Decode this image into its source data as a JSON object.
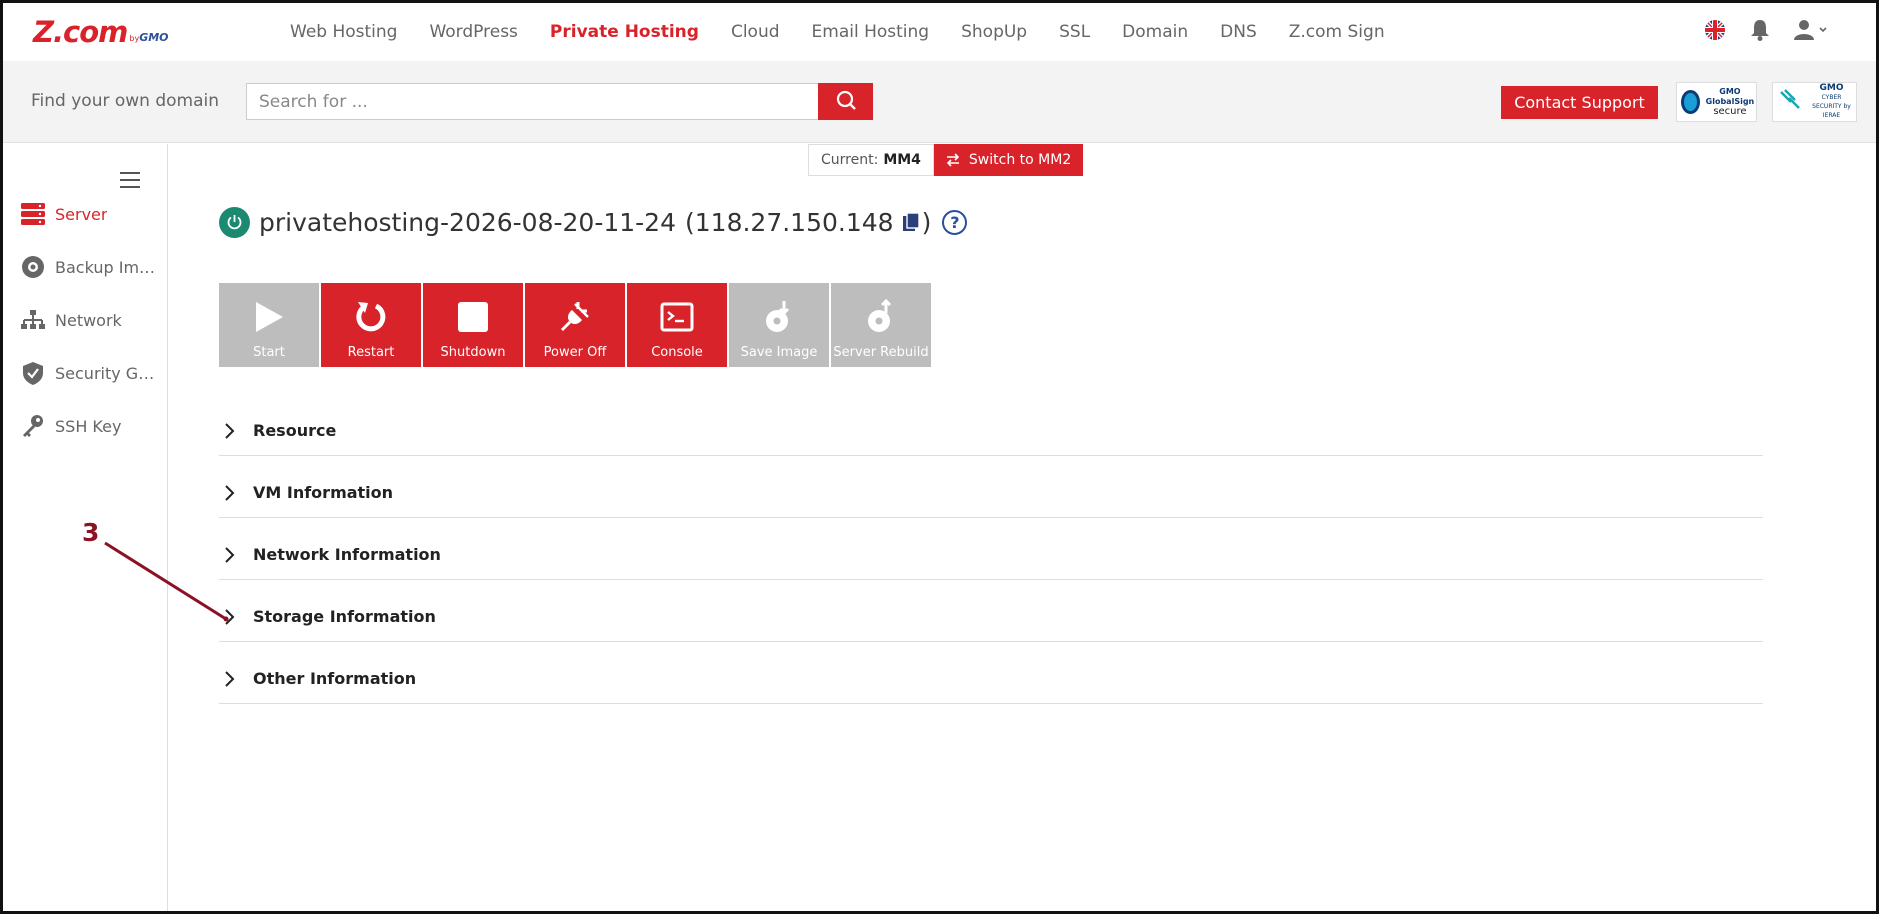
{
  "logo": {
    "main": "Z.com",
    "by": "by",
    "gmo": "GMO"
  },
  "nav": {
    "items": [
      "Web Hosting",
      "WordPress",
      "Private Hosting",
      "Cloud",
      "Email Hosting",
      "ShopUp",
      "SSL",
      "Domain",
      "DNS",
      "Z.com Sign"
    ],
    "active": "Private Hosting"
  },
  "domainbar": {
    "label": "Find your own domain",
    "search_placeholder": "Search for ...",
    "contact_label": "Contact Support",
    "badge1": {
      "brand": "GMO GlobalSign",
      "word": "secure"
    },
    "badge2": {
      "brand": "GMO",
      "sub": "CYBER SECURITY by IERAE"
    }
  },
  "sidebar": {
    "items": [
      {
        "label": "Server",
        "icon": "server-icon",
        "active": true
      },
      {
        "label": "Backup Image",
        "icon": "disc-icon",
        "active": false
      },
      {
        "label": "Network",
        "icon": "network-icon",
        "active": false
      },
      {
        "label": "Security Group",
        "icon": "shield-icon",
        "active": false
      },
      {
        "label": "SSH Key",
        "icon": "key-icon",
        "active": false
      }
    ]
  },
  "mm": {
    "current_label": "Current:",
    "current_value": "MM4",
    "switch_label": "Switch to MM2"
  },
  "server": {
    "name": "privatehosting-2026-08-20-11-24",
    "ip": "(118.27.150.148",
    "close_paren": ")",
    "help": "?"
  },
  "actions": [
    {
      "label": "Start",
      "state": "disabled"
    },
    {
      "label": "Restart",
      "state": "enabled"
    },
    {
      "label": "Shutdown",
      "state": "enabled"
    },
    {
      "label": "Power Off",
      "state": "enabled"
    },
    {
      "label": "Console",
      "state": "enabled"
    },
    {
      "label": "Save Image",
      "state": "disabled"
    },
    {
      "label": "Server Rebuild",
      "state": "disabled"
    }
  ],
  "accordion": [
    "Resource",
    "VM Information",
    "Network Information",
    "Storage Information",
    "Other Information"
  ],
  "annotation": {
    "number": "3"
  },
  "colors": {
    "brand_red": "#d8232a",
    "power_green": "#1b8a70",
    "disabled_grey": "#bdbdbd",
    "annotation": "#8b1224"
  }
}
